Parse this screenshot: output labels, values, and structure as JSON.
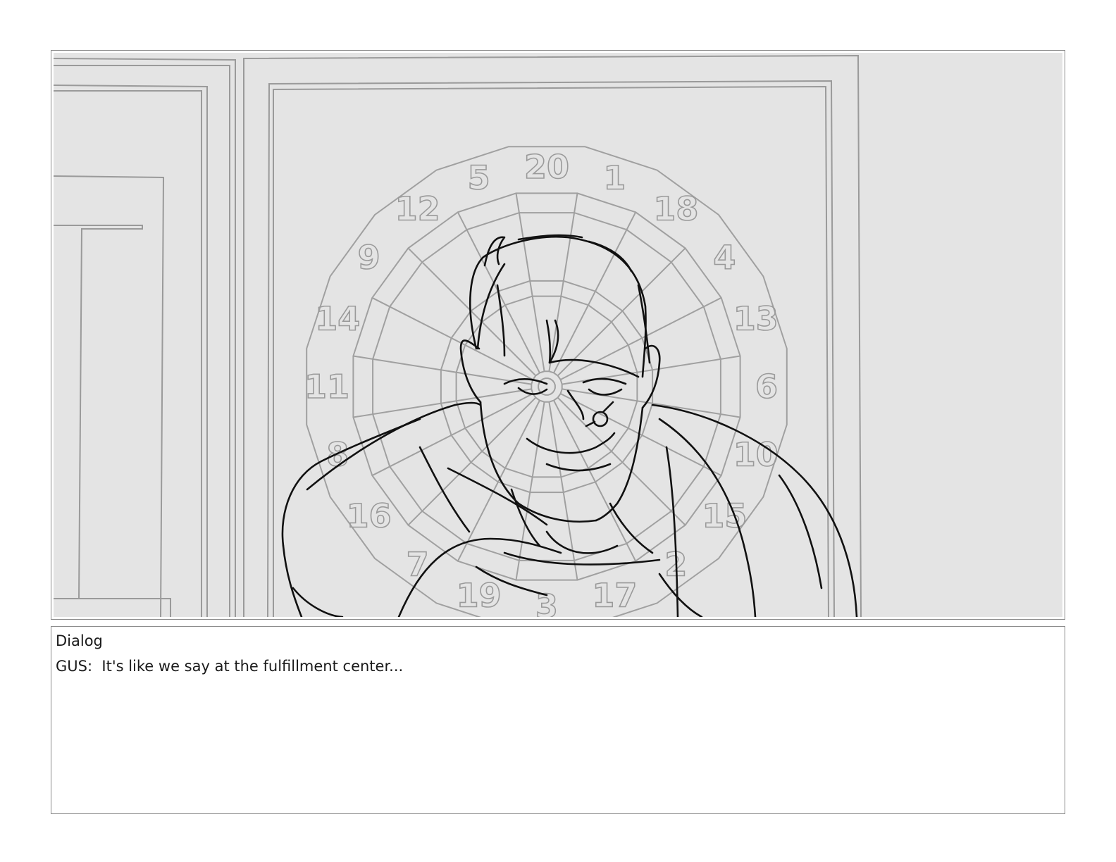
{
  "dialog": {
    "heading": "Dialog",
    "line": "GUS:  It's like we say at the fulfillment center..."
  },
  "panel": {
    "background_color": "#e4e4e4",
    "line_color": "#a0a0a0",
    "ink_color": "#111111",
    "dartboard_numbers": [
      "20",
      "1",
      "18",
      "4",
      "13",
      "6",
      "10",
      "15",
      "2",
      "17",
      "3",
      "19",
      "7",
      "16",
      "8",
      "11",
      "14",
      "9",
      "12",
      "5"
    ]
  }
}
